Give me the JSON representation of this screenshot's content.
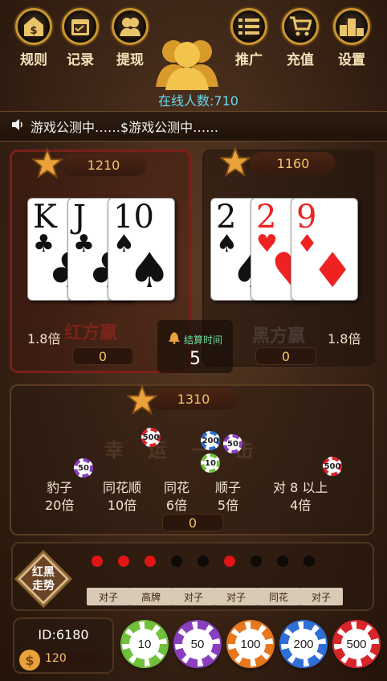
{
  "top_nav": {
    "rules": "规则",
    "records": "记录",
    "withdraw": "提现",
    "promote": "推广",
    "recharge": "充值",
    "settings": "设置"
  },
  "online": "在线人数:710",
  "marquee": "游戏公测中……$游戏公测中……",
  "red_side": {
    "total": "1210",
    "cards": [
      {
        "rank": "K",
        "suit": "♣",
        "color": "black"
      },
      {
        "rank": "J",
        "suit": "♣",
        "color": "black"
      },
      {
        "rank": "10",
        "suit": "♠",
        "color": "black"
      }
    ],
    "multiplier": "1.8倍",
    "bet": "0",
    "watermark": "红方赢"
  },
  "black_side": {
    "total": "1160",
    "cards": [
      {
        "rank": "2",
        "suit": "♠",
        "color": "black"
      },
      {
        "rank": "2",
        "suit": "♥",
        "color": "red"
      },
      {
        "rank": "9",
        "suit": "♦",
        "color": "red"
      }
    ],
    "multiplier": "1.8倍",
    "bet": "0",
    "watermark": "黑方赢"
  },
  "timer": {
    "label": "结算时间",
    "value": "5"
  },
  "lucky": {
    "total": "1310",
    "types": [
      {
        "name": "豹子",
        "odds": "20倍"
      },
      {
        "name": "同花顺",
        "odds": "10倍"
      },
      {
        "name": "同花",
        "odds": "6倍"
      },
      {
        "name": "顺子",
        "odds": "5倍"
      },
      {
        "name": "对 8 以上",
        "odds": "4倍"
      }
    ],
    "bet": "0",
    "watermark": "幸运一击"
  },
  "trend": {
    "label_line1": "红黑",
    "label_line2": "走势",
    "dots": [
      "red",
      "red",
      "red",
      "black",
      "black",
      "red",
      "black",
      "black",
      "black"
    ],
    "tags": [
      "对子",
      "高牌",
      "对子",
      "对子",
      "同花",
      "对子"
    ]
  },
  "player": {
    "id": "ID:6180",
    "coins": "120"
  },
  "chips": [
    {
      "value": "10",
      "color": "#6fc23a"
    },
    {
      "value": "50",
      "color": "#8a3fc0"
    },
    {
      "value": "100",
      "color": "#e8781e"
    },
    {
      "value": "200",
      "color": "#2f6fd8"
    },
    {
      "value": "500",
      "color": "#d8262a"
    }
  ],
  "table_chips": [
    {
      "value": "500",
      "color": "#d8262a"
    },
    {
      "value": "200",
      "color": "#2f6fd8"
    },
    {
      "value": "50",
      "color": "#8a3fc0"
    },
    {
      "value": "10",
      "color": "#6fc23a"
    },
    {
      "value": "50",
      "color": "#8a3fc0"
    },
    {
      "value": "500",
      "color": "#d8262a"
    }
  ]
}
